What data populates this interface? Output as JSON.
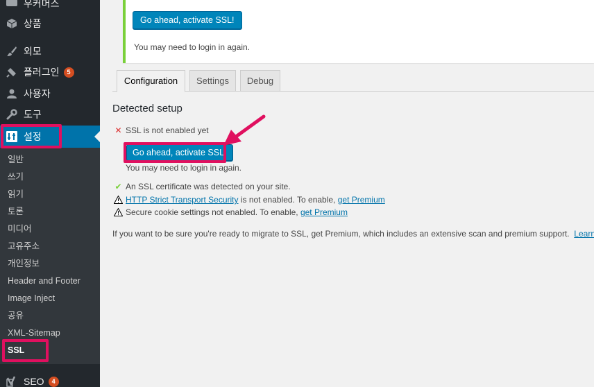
{
  "sidebar": {
    "items": [
      {
        "label": "우커머스",
        "icon": "woocommerce-icon"
      },
      {
        "label": "상품",
        "icon": "products-cube-icon"
      },
      {
        "label": "외모",
        "icon": "appearance-brush-icon"
      },
      {
        "label": "플러그인",
        "icon": "plugins-plug-icon",
        "badge": "5"
      },
      {
        "label": "사용자",
        "icon": "users-person-icon"
      },
      {
        "label": "도구",
        "icon": "tools-wrench-icon"
      },
      {
        "label": "설정",
        "icon": "settings-sliders-icon"
      }
    ],
    "submenu": [
      "일반",
      "쓰기",
      "읽기",
      "토론",
      "미디어",
      "고유주소",
      "개인정보",
      "Header and Footer",
      "Image Inject",
      "공유",
      "XML-Sitemap",
      "SSL"
    ],
    "seo": {
      "label": "SEO",
      "icon": "yoast-seo-icon",
      "badge": "4"
    }
  },
  "notice": {
    "button_label": "Go ahead, activate SSL!",
    "note": "You may need to login in again."
  },
  "tabs": [
    "Configuration",
    "Settings",
    "Debug"
  ],
  "detected": {
    "title": "Detected setup",
    "ssl_status": "SSL is not enabled yet",
    "button_label": "Go ahead, activate SSL!",
    "note": "You may need to login in again.",
    "cert_detected": "An SSL certificate was detected on your site.",
    "hsts_link": "HTTP Strict Transport Security",
    "hsts_text": " is not enabled. To enable, ",
    "get_premium": "get Premium",
    "cookie_text": "Secure cookie settings not enabled. To enable, ",
    "premium_line": "If you want to be sure you're ready to migrate to SSL, get Premium, which includes an extensive scan and premium support.  ",
    "learn_more": "Learn more"
  },
  "colors": {
    "sidebar_bg": "#23282d",
    "active": "#0073aa",
    "button": "#0085ba",
    "highlight": "#e0105f",
    "notice_border": "#7ad03a",
    "error": "#dc3232",
    "badge": "#d54e21"
  }
}
